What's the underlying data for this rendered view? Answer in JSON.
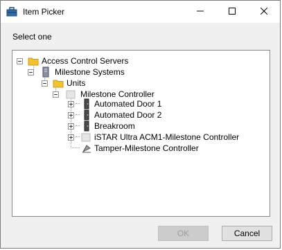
{
  "window": {
    "title": "Item Picker",
    "controls": {
      "minimize": "minimize",
      "maximize": "maximize",
      "close": "close"
    }
  },
  "prompt": "Select one",
  "tree": {
    "nodes": [
      {
        "label": "Access Control Servers",
        "icon": "folder-icon",
        "expander": "expanded"
      },
      {
        "label": "Milestone Systems",
        "icon": "server-icon",
        "expander": "expanded"
      },
      {
        "label": "Units",
        "icon": "folder-icon",
        "expander": "expanded"
      },
      {
        "label": "Milestone Controller",
        "icon": "controller-icon",
        "expander": "expanded"
      },
      {
        "label": "Automated Door 1",
        "icon": "door-icon",
        "expander": "collapsed"
      },
      {
        "label": "Automated Door 2",
        "icon": "door-icon",
        "expander": "collapsed"
      },
      {
        "label": "Breakroom",
        "icon": "door-icon",
        "expander": "collapsed"
      },
      {
        "label": "iSTAR Ultra ACM1-Milestone Controller",
        "icon": "controller-icon",
        "expander": "collapsed"
      },
      {
        "label": "Tamper-Milestone Controller",
        "icon": "tamper-icon",
        "expander": "none"
      }
    ]
  },
  "buttons": {
    "ok": "OK",
    "cancel": "Cancel",
    "ok_enabled": false
  },
  "colors": {
    "folder": "#f4c430",
    "tree_border": "#828790",
    "disabled_text": "#9c9c9c"
  }
}
